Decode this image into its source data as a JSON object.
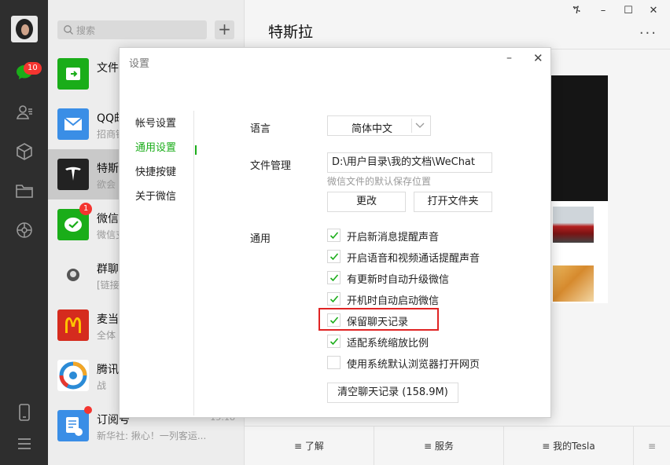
{
  "window": {
    "controls": [
      "ጙ",
      "–",
      "☐",
      "✕"
    ]
  },
  "rail": {
    "chat_badge": "10"
  },
  "search": {
    "placeholder": "搜索"
  },
  "chats": [
    {
      "name": "文件",
      "preview": ""
    },
    {
      "name": "QQ邮",
      "preview": "招商银"
    },
    {
      "name": "特斯",
      "preview": "欲会"
    },
    {
      "name": "微信",
      "preview": "微信支",
      "badge": "1"
    },
    {
      "name": "群聊",
      "preview": "[链接"
    },
    {
      "name": "麦当",
      "preview": "全体"
    },
    {
      "name": "腾讯",
      "preview": "战 "
    },
    {
      "name": "订阅号",
      "preview": "新华社: 揪心！一列客运...",
      "time": "15:18"
    }
  ],
  "main": {
    "title": "特斯拉",
    "more": "···",
    "menu": [
      "了解",
      "服务",
      "我的Tesla"
    ],
    "menu_icon": "≡"
  },
  "dialog": {
    "title": "设置",
    "min": "–",
    "close": "✕",
    "nav": [
      "帐号设置",
      "通用设置",
      "快捷按键",
      "关于微信"
    ],
    "language_label": "语言",
    "language_value": "简体中文",
    "file_label": "文件管理",
    "file_path": "D:\\用户目录\\我的文档\\WeChat",
    "file_hint": "微信文件的默认保存位置",
    "change_btn": "更改",
    "open_folder_btn": "打开文件夹",
    "general_label": "通用",
    "options": [
      {
        "label": "开启新消息提醒声音",
        "checked": true
      },
      {
        "label": "开启语音和视频通话提醒声音",
        "checked": true
      },
      {
        "label": "有更新时自动升级微信",
        "checked": true
      },
      {
        "label": "开机时自动启动微信",
        "checked": true
      },
      {
        "label": "保留聊天记录",
        "checked": true
      },
      {
        "label": "适配系统缩放比例",
        "checked": true
      },
      {
        "label": "使用系统默认浏览器打开网页",
        "checked": false
      }
    ],
    "clear_btn": "清空聊天记录 (158.9M)"
  },
  "colors": {
    "accent_green": "#1aad19",
    "highlight_red": "#e02424",
    "badge_red": "#f43530",
    "rail_bg": "#2e2e2e"
  },
  "icons": {
    "rail": [
      "chat-icon",
      "contacts-icon",
      "favorites-cube-icon",
      "folder-icon",
      "moments-icon",
      "phone-icon",
      "menu-icon"
    ]
  }
}
